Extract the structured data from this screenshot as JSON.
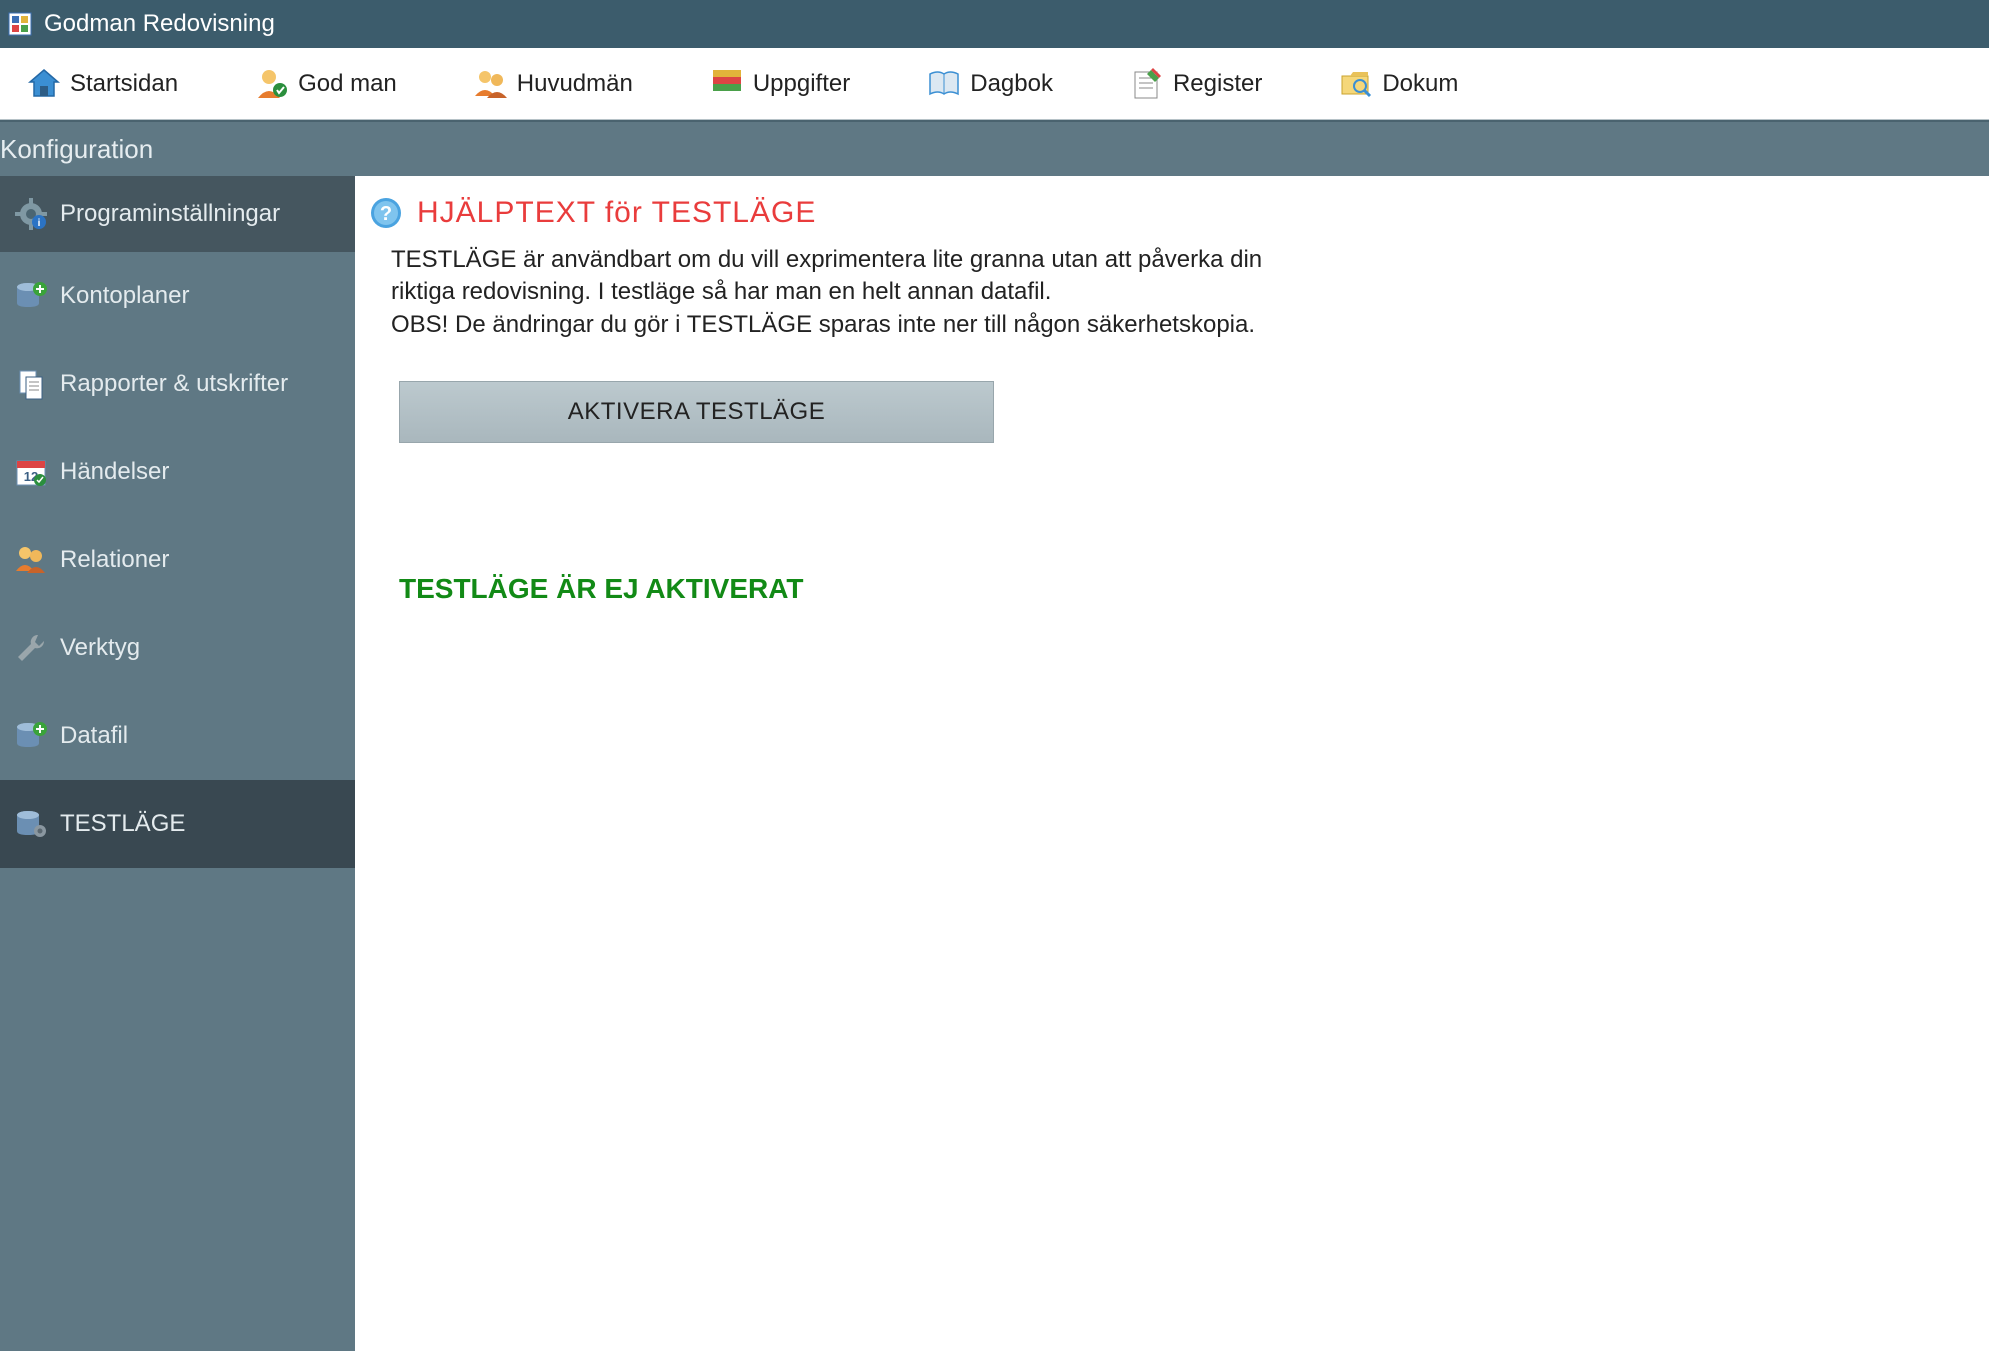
{
  "window": {
    "title": "Godman Redovisning"
  },
  "toolbar": {
    "items": [
      {
        "id": "startsidan",
        "label": "Startsidan",
        "icon": "home-icon"
      },
      {
        "id": "godman",
        "label": "God man",
        "icon": "person-badge-icon"
      },
      {
        "id": "huvudman",
        "label": "Huvudmän",
        "icon": "people-icon"
      },
      {
        "id": "uppgifter",
        "label": "Uppgifter",
        "icon": "books-icon"
      },
      {
        "id": "dagbok",
        "label": "Dagbok",
        "icon": "book-open-icon"
      },
      {
        "id": "register",
        "label": "Register",
        "icon": "notepad-icon"
      },
      {
        "id": "dokument",
        "label": "Dokum",
        "icon": "search-folder-icon"
      }
    ]
  },
  "section": {
    "title": "Konfiguration"
  },
  "sidebar": {
    "items": [
      {
        "id": "programsettings",
        "label": "Programinställningar",
        "icon": "gear-icon",
        "selected": true
      },
      {
        "id": "kontoplaner",
        "label": "Kontoplaner",
        "icon": "database-plus-icon"
      },
      {
        "id": "rapporter",
        "label": "Rapporter & utskrifter",
        "icon": "documents-icon"
      },
      {
        "id": "handelser",
        "label": "Händelser",
        "icon": "calendar-icon"
      },
      {
        "id": "relationer",
        "label": "Relationer",
        "icon": "people-icon"
      },
      {
        "id": "verktyg",
        "label": "Verktyg",
        "icon": "wrench-icon"
      },
      {
        "id": "datafil",
        "label": "Datafil",
        "icon": "database-plus-icon"
      },
      {
        "id": "testlage",
        "label": "TESTLÄGE",
        "icon": "database-gear-icon",
        "dark": true
      }
    ]
  },
  "content": {
    "help_title": "HJÄLPTEXT  för  TESTLÄGE",
    "help_body": "TESTLÄGE är användbart om du vill exprimentera lite granna utan att påverka din riktiga redovisning. I testläge så har man en helt annan datafil.\nOBS! De ändringar du gör i TESTLÄGE sparas inte ner till någon säkerhetskopia.",
    "activate_button": "AKTIVERA TESTLÄGE",
    "status": "TESTLÄGE ÄR EJ AKTIVERAT"
  },
  "colors": {
    "titlebar": "#3c5c6c",
    "section": "#5f7884",
    "sidebar_selected": "#45565f",
    "sidebar_dark": "#394851",
    "help_title": "#e93c3c",
    "status_green": "#128a16"
  }
}
